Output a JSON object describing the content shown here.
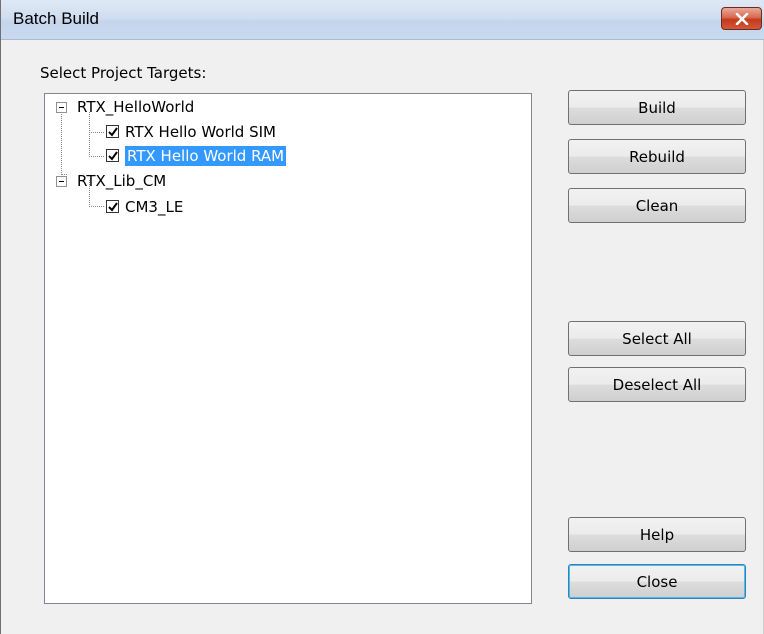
{
  "window": {
    "title": "Batch Build"
  },
  "dialog": {
    "targets_label": "Select Project Targets:",
    "tree": [
      {
        "label": "RTX_HelloWorld",
        "children": [
          {
            "label": "RTX Hello World SIM",
            "checked": true
          },
          {
            "label": "RTX Hello World RAM",
            "checked": true,
            "selected": true
          }
        ]
      },
      {
        "label": "RTX_Lib_CM",
        "children": [
          {
            "label": "CM3_LE",
            "checked": true
          }
        ]
      }
    ],
    "buttons": {
      "build": "Build",
      "rebuild": "Rebuild",
      "clean": "Clean",
      "select_all": "Select All",
      "deselect_all": "Deselect All",
      "help": "Help",
      "close": "Close"
    }
  },
  "colors": {
    "selection": "#3399ff",
    "title_close": "#c43a1b"
  }
}
